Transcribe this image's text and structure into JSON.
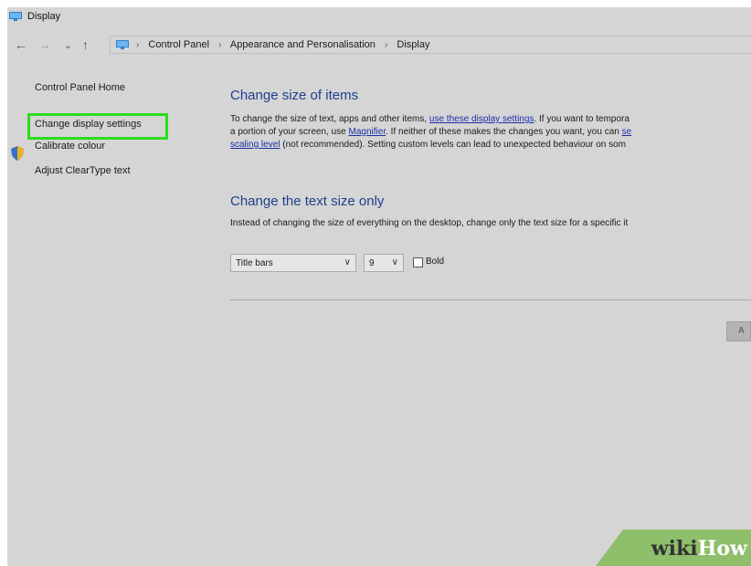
{
  "window": {
    "title": "Display"
  },
  "nav": {
    "back_icon": "←",
    "forward_icon": "→",
    "recent_icon": "⌄",
    "up_icon": "↑",
    "separator": "›",
    "breadcrumbs": [
      "Control Panel",
      "Appearance and Personalisation",
      "Display"
    ]
  },
  "sidebar": {
    "items": [
      {
        "label": "Control Panel Home"
      },
      {
        "label": "Change display settings"
      },
      {
        "label": "Calibrate colour"
      },
      {
        "label": "Adjust ClearType text"
      }
    ]
  },
  "main": {
    "size_section": {
      "heading": "Change size of items",
      "line1_a": "To change the size of text, apps and other items, ",
      "line1_link": "use these display settings",
      "line1_b": ". If you want to tempora",
      "line2_a": "a portion of your screen, use ",
      "line2_link1": "Magnifier",
      "line2_b": ". If neither of these makes the changes you want, you can ",
      "line2_link2": "se",
      "line3_link": "scaling level",
      "line3_b": " (not recommended). Setting custom levels can lead to unexpected behaviour on som"
    },
    "text_section": {
      "heading": "Change the text size only",
      "description": "Instead of changing the size of everything on the desktop, change only the text size for a specific it",
      "element_select": "Title bars",
      "size_select": "9",
      "bold_label": "Bold",
      "bold_checked": false
    },
    "apply_label": "A"
  },
  "watermark": {
    "wiki": "wiki",
    "how": "How"
  },
  "colors": {
    "window_bg": "#d5d5d5",
    "heading": "#1f3f8f",
    "link": "#1b2fa7",
    "highlight": "#2cdc1e",
    "watermark_bg": "#8fbf6a"
  }
}
